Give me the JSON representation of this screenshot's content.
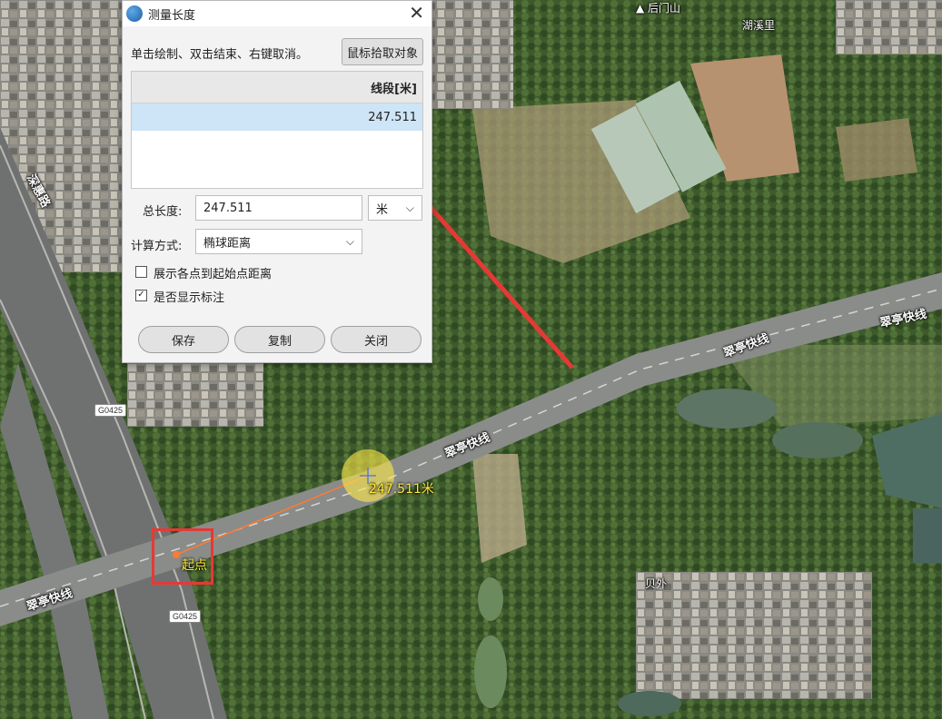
{
  "dialog": {
    "title": "测量长度",
    "hint": "单击绘制、双击结束、右键取消。",
    "pick_button": "鼠标拾取对象",
    "table": {
      "column_header": "线段[米]",
      "rows": [
        "247.511"
      ]
    },
    "total_length_label": "总长度:",
    "total_length_value": "247.511",
    "unit": "米",
    "calc_method_label": "计算方式:",
    "calc_method_value": "椭球距离",
    "checkbox_show_distance": {
      "label": "展示各点到起始点距离",
      "checked": false
    },
    "checkbox_show_annotation": {
      "label": "是否显示标注",
      "checked": true
    },
    "buttons": {
      "save": "保存",
      "copy": "复制",
      "close": "关闭"
    }
  },
  "map": {
    "measurement_label": "247.511米",
    "start_label": "起点",
    "place_labels": {
      "houmenshan": "后门山",
      "huxili": "湖溪里",
      "beiwai": "贝外"
    },
    "road_labels": {
      "cuiting_1": "翠亭快线",
      "cuiting_2": "翠亭快线",
      "cuiting_3": "翠亭快线",
      "left_road": "深惠路"
    },
    "highway_shields": [
      "G0425",
      "G0425"
    ]
  },
  "colors": {
    "measure_line": "#ff7a30",
    "annotation_arrow": "#e53935",
    "highlight_box": "#e53935",
    "label_text": "#ffeb3b"
  }
}
